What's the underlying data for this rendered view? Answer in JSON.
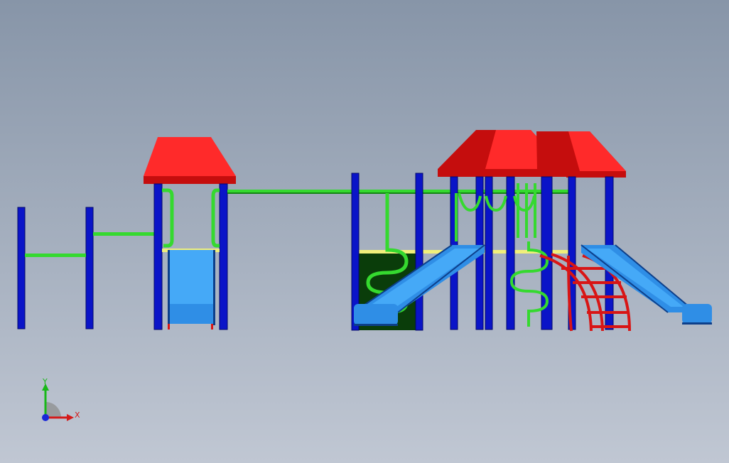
{
  "viewport": {
    "background_top": "#8795a8",
    "background_bottom": "#c0c7d3"
  },
  "colors": {
    "post": "#0a14c8",
    "post_edge": "#02086a",
    "roof": "#ff2a2a",
    "roof_dark": "#c50d0d",
    "rail": "#35d92f",
    "rail_dark": "#138512",
    "slide": "#2f8ee6",
    "slide_light": "#45a9f7",
    "slide_edge": "#0d3f8a",
    "panel": "#0a3d0a",
    "climber": "#d81515",
    "deck": "#f0ef7a"
  },
  "triad": {
    "y_label": "Y",
    "x_label": "X",
    "y_icon": "y-axis-arrow-icon",
    "x_icon": "x-axis-arrow-icon",
    "z_icon": "z-axis-dot-icon"
  }
}
